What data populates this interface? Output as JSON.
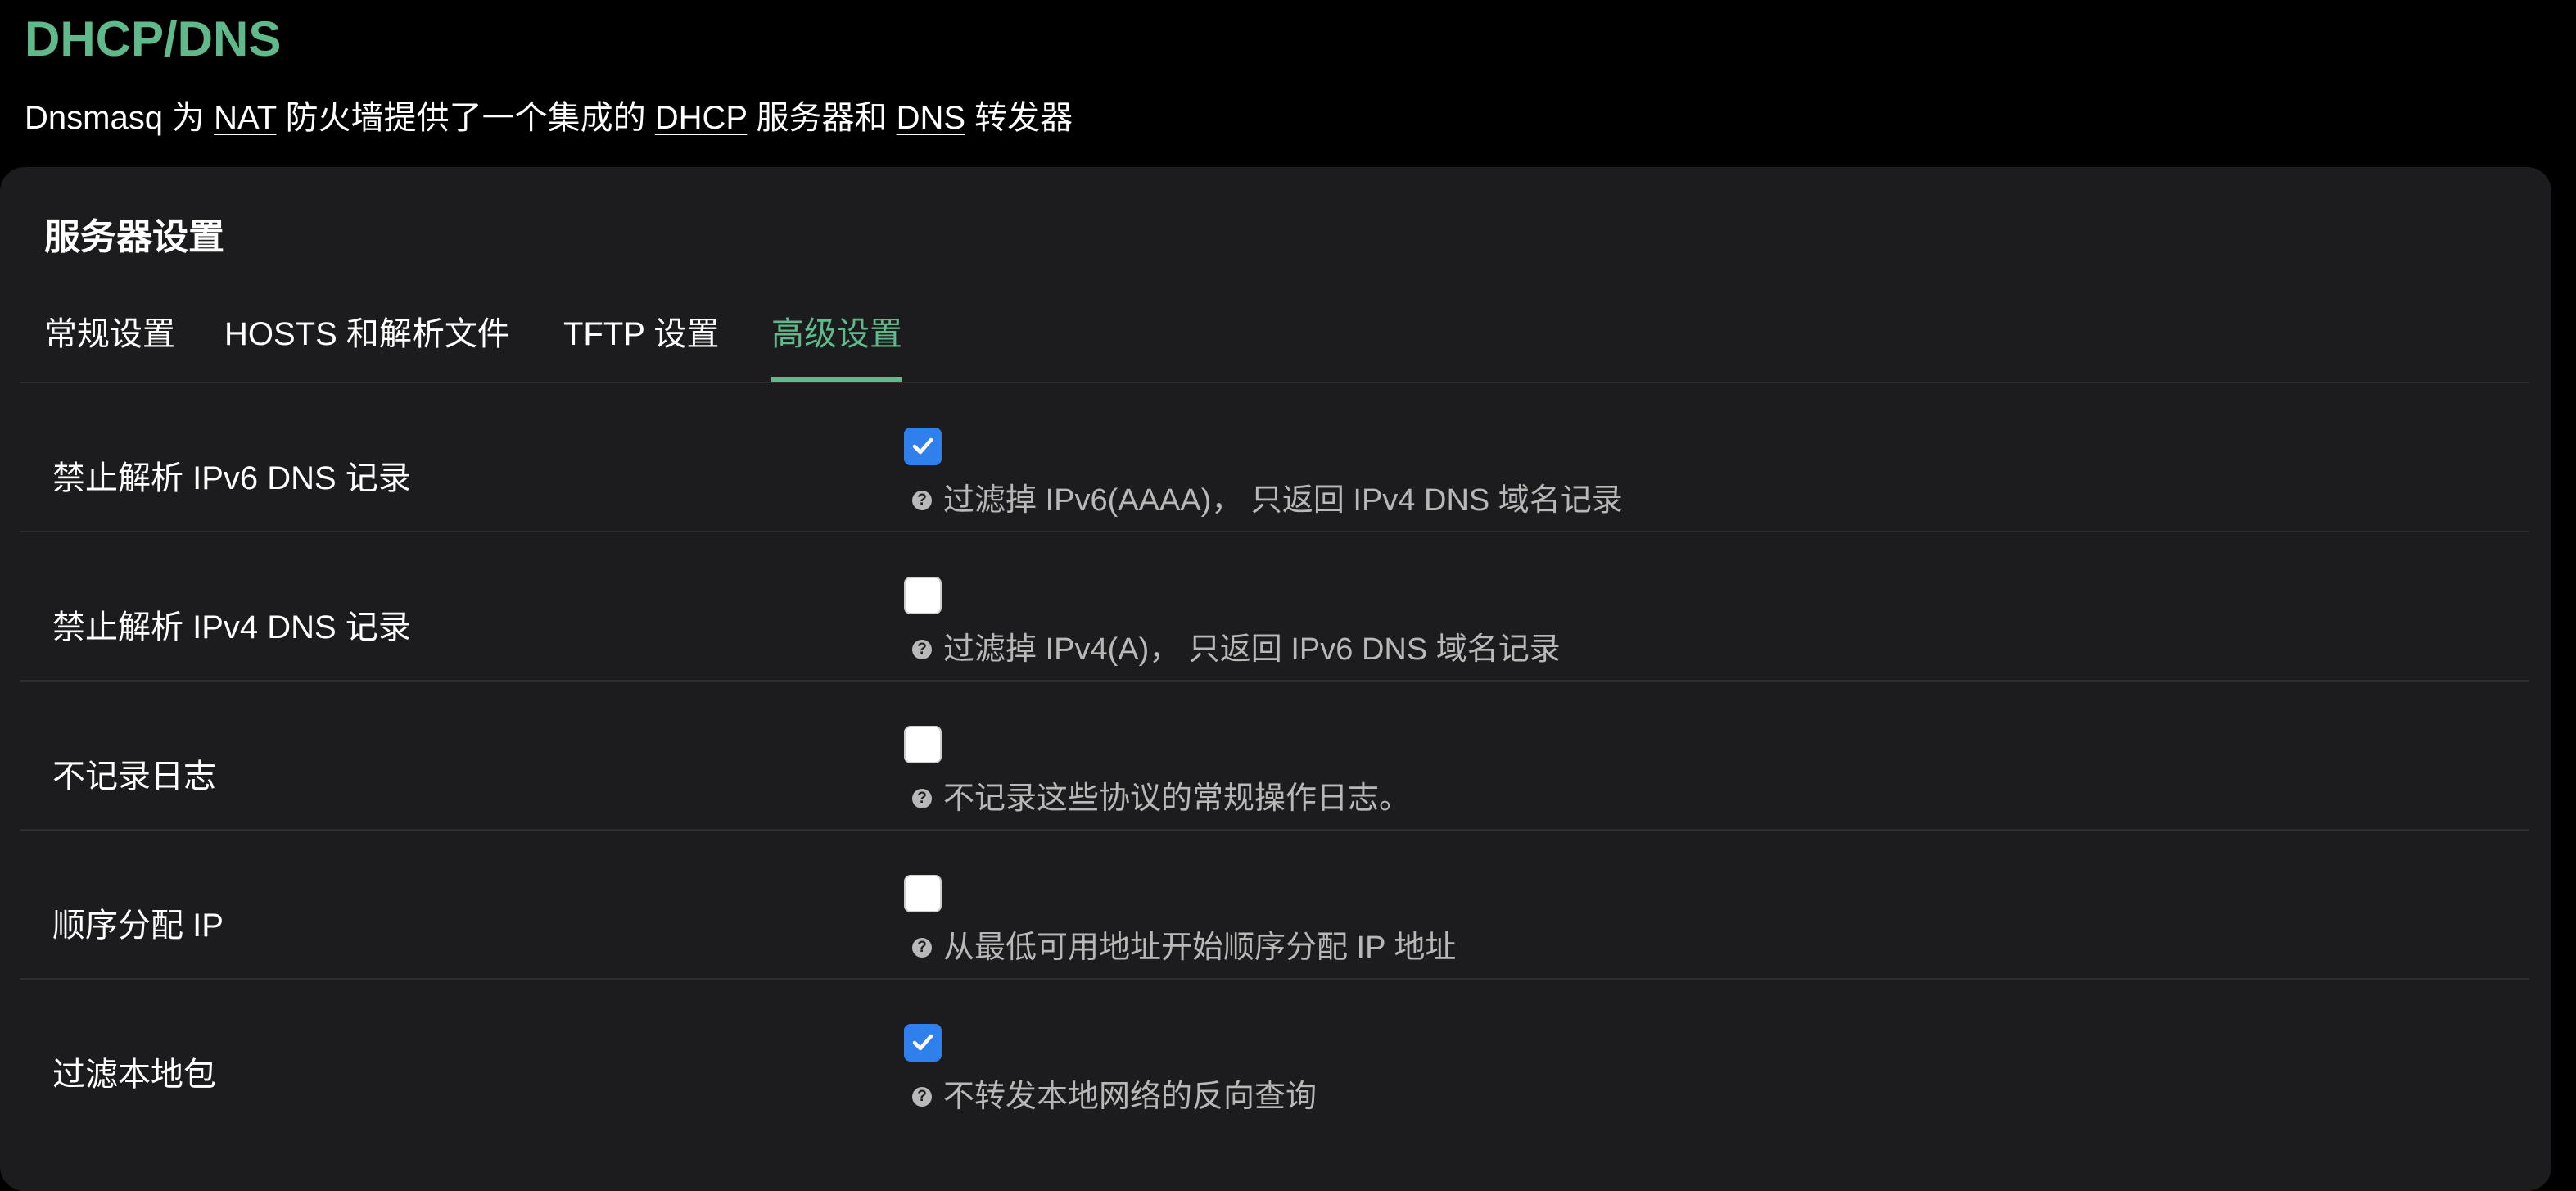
{
  "header": {
    "title": "DHCP/DNS",
    "description": {
      "part1": "Dnsmasq 为 ",
      "nat": "NAT",
      "part2": " 防火墙提供了一个集成的 ",
      "dhcp": "DHCP",
      "part3": " 服务器和 ",
      "dns": "DNS",
      "part4": " 转发器"
    }
  },
  "section": {
    "title": "服务器设置"
  },
  "tabs": [
    {
      "label": "常规设置",
      "active": false
    },
    {
      "label": "HOSTS 和解析文件",
      "active": false
    },
    {
      "label": "TFTP 设置",
      "active": false
    },
    {
      "label": "高级设置",
      "active": true
    }
  ],
  "options": [
    {
      "label": "禁止解析 IPv6 DNS 记录",
      "checked": true,
      "help_icon": "?",
      "help": "过滤掉 IPv6(AAAA)， 只返回 IPv4 DNS 域名记录"
    },
    {
      "label": "禁止解析 IPv4 DNS 记录",
      "checked": false,
      "help_icon": "?",
      "help": "过滤掉 IPv4(A)， 只返回 IPv6 DNS 域名记录"
    },
    {
      "label": "不记录日志",
      "checked": false,
      "help_icon": "?",
      "help": "不记录这些协议的常规操作日志。"
    },
    {
      "label": "顺序分配 IP",
      "checked": false,
      "help_icon": "?",
      "help": "从最低可用地址开始顺序分配 IP 地址"
    },
    {
      "label": "过滤本地包",
      "checked": true,
      "help_icon": "?",
      "help": "不转发本地网络的反向查询"
    }
  ],
  "colors": {
    "accent": "#5fb98a",
    "checkbox_checked": "#2f80ed",
    "panel_bg": "#1c1c1e",
    "page_bg": "#000000",
    "help_text": "#b8b8b8"
  }
}
